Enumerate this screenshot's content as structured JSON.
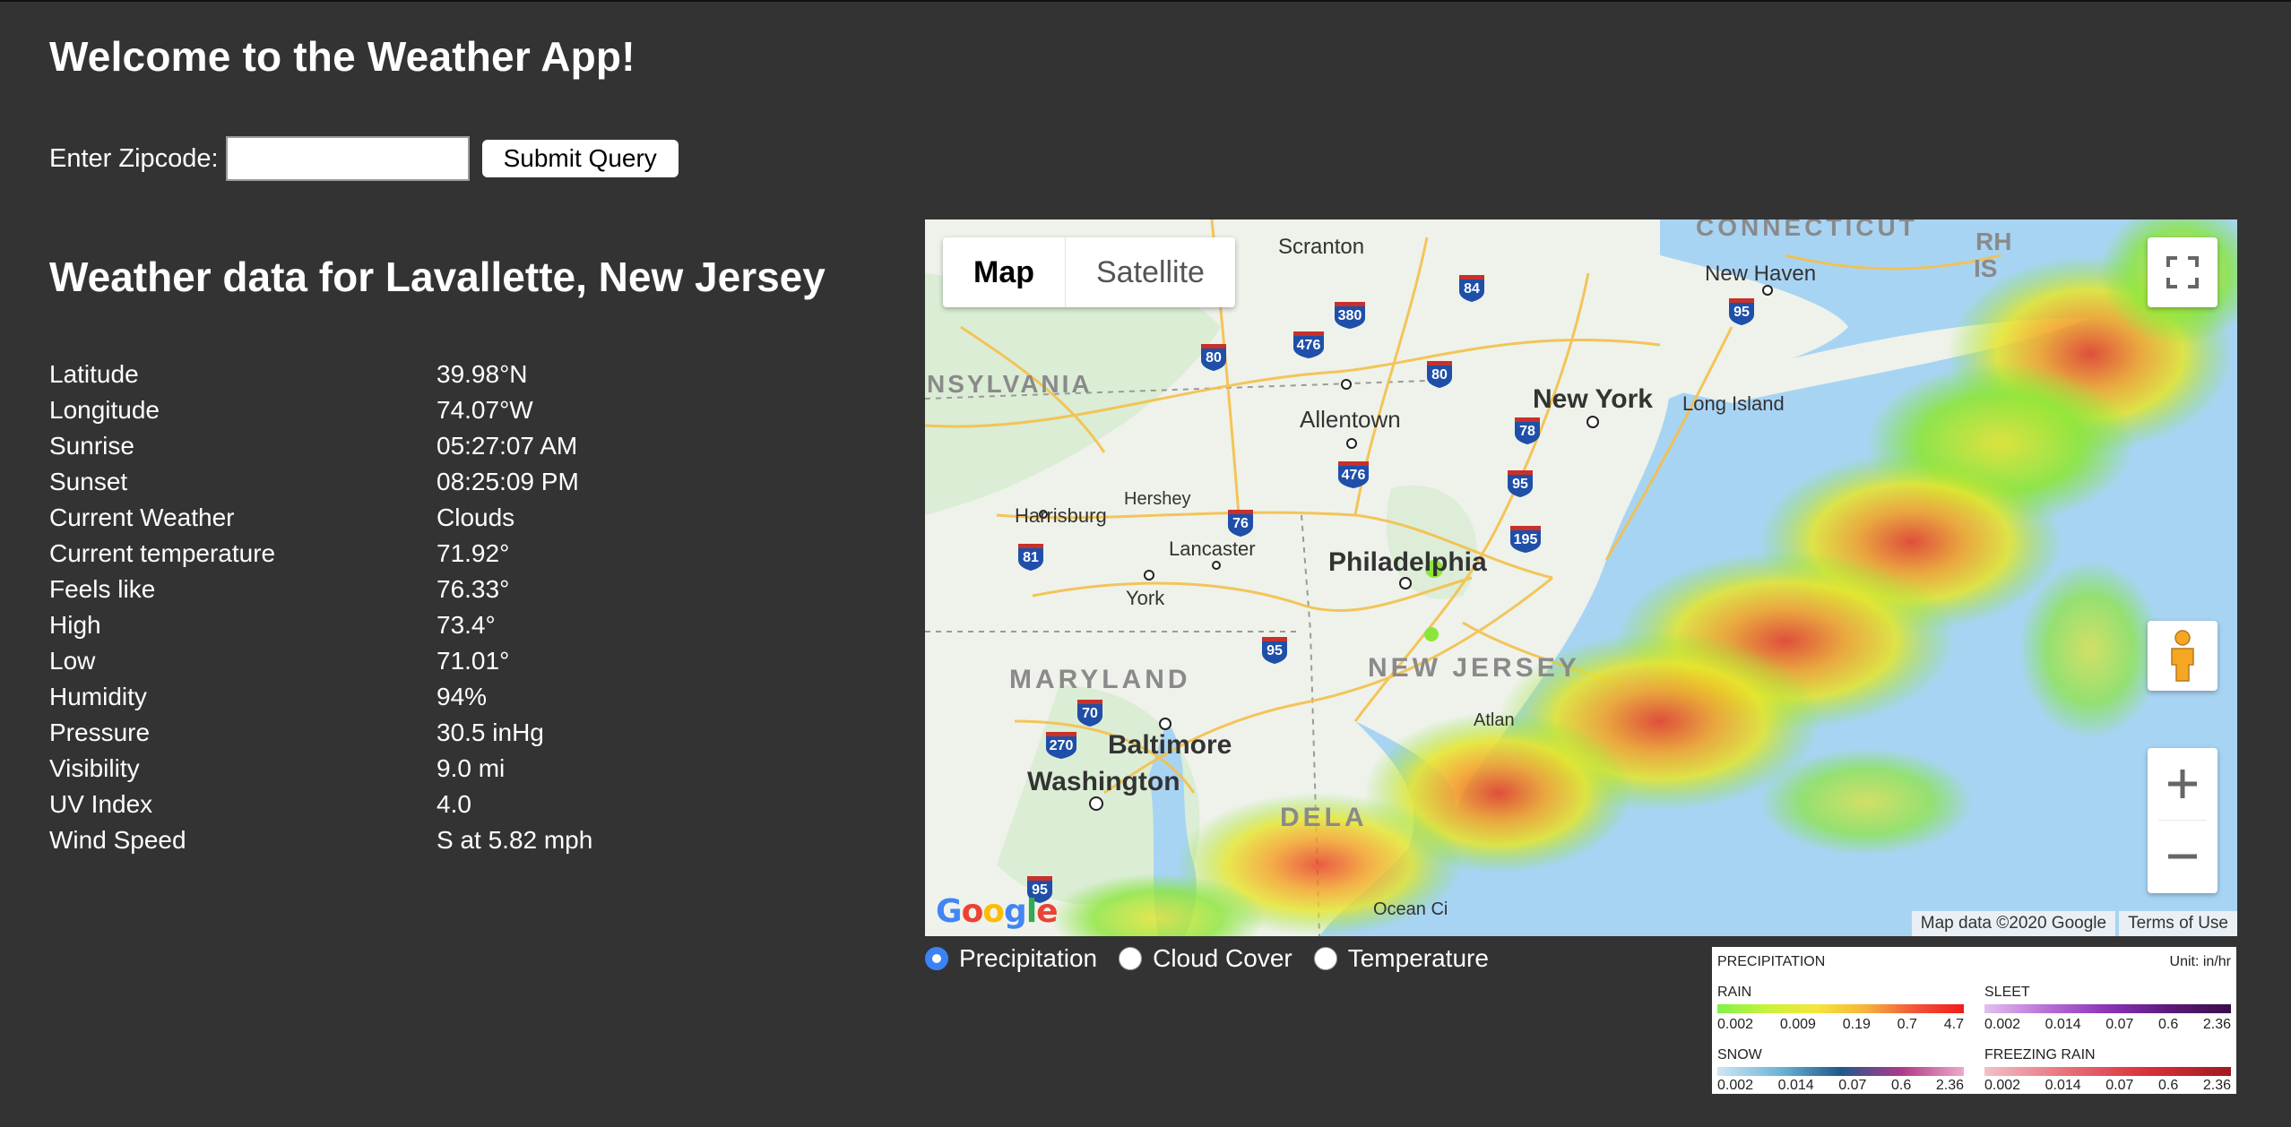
{
  "app": {
    "title": "Welcome to the Weather App!"
  },
  "zip_form": {
    "label": "Enter Zipcode:",
    "value": "",
    "submit_label": "Submit Query"
  },
  "location": {
    "heading": "Weather data for Lavallette, New Jersey"
  },
  "weather": {
    "rows": [
      {
        "label": "Latitude",
        "value": "39.98°N"
      },
      {
        "label": "Longitude",
        "value": "74.07°W"
      },
      {
        "label": "Sunrise",
        "value": "05:27:07 AM"
      },
      {
        "label": "Sunset",
        "value": "08:25:09 PM"
      },
      {
        "label": "Current Weather",
        "value": "Clouds"
      },
      {
        "label": "Current temperature",
        "value": "71.92°"
      },
      {
        "label": "Feels like",
        "value": "76.33°"
      },
      {
        "label": "High",
        "value": "73.4°"
      },
      {
        "label": "Low",
        "value": "71.01°"
      },
      {
        "label": "Humidity",
        "value": "94%"
      },
      {
        "label": "Pressure",
        "value": "30.5 inHg"
      },
      {
        "label": "Visibility",
        "value": "9.0 mi"
      },
      {
        "label": "UV Index",
        "value": "4.0"
      },
      {
        "label": "Wind Speed",
        "value": "S at 5.82 mph"
      }
    ]
  },
  "map": {
    "type_options": [
      "Map",
      "Satellite"
    ],
    "selected_type": "Map",
    "icons": [
      "fullscreen-icon",
      "pegman-icon",
      "zoom-in-icon",
      "zoom-out-icon"
    ],
    "logo": "Google",
    "attribution": "Map data ©2020 Google",
    "terms": "Terms of Use",
    "labels": {
      "connecticut": "CONNECTICUT",
      "rhode_island_a": "RH",
      "rhode_island_b": "IS",
      "scranton": "Scranton",
      "new_haven": "New Haven",
      "pennsylvania": "NSYLVANIA",
      "new_york": "New York",
      "long_island": "Long Island",
      "allentown": "Allentown",
      "harrisburg": "Harrisburg",
      "hershey": "Hershey",
      "lancaster": "Lancaster",
      "philadelphia": "Philadelphia",
      "york": "York",
      "maryland": "MARYLAND",
      "new_jersey": "NEW JERSEY",
      "atlantic": "Atlan",
      "baltimore": "Baltimore",
      "washington": "Washington",
      "delaware": "DELA",
      "ocean_city": "Ocean Ci"
    },
    "highway_shields": [
      "84",
      "380",
      "476",
      "80",
      "80",
      "95",
      "78",
      "476",
      "95",
      "76",
      "195",
      "81",
      "95",
      "70",
      "270",
      "95"
    ]
  },
  "layers": {
    "options": [
      "Precipitation",
      "Cloud Cover",
      "Temperature"
    ],
    "selected": "Precipitation"
  },
  "legend": {
    "title": "PRECIPITATION",
    "unit": "Unit: in/hr",
    "rain": {
      "label": "RAIN",
      "ticks": [
        "0.002",
        "0.009",
        "0.19",
        "0.7",
        "4.7"
      ]
    },
    "sleet": {
      "label": "SLEET",
      "ticks": [
        "0.002",
        "0.014",
        "0.07",
        "0.6",
        "2.36"
      ]
    },
    "snow": {
      "label": "SNOW",
      "ticks": [
        "0.002",
        "0.014",
        "0.07",
        "0.6",
        "2.36"
      ]
    },
    "freezing_rain": {
      "label": "FREEZING RAIN",
      "ticks": [
        "0.002",
        "0.014",
        "0.07",
        "0.6",
        "2.36"
      ]
    },
    "colors": {
      "rain": [
        "#7ff24a",
        "#c8f23a",
        "#f5e63a",
        "#f5b53a",
        "#f2553a"
      ],
      "sleet": [
        "#d9a8e8",
        "#b770d6",
        "#8a34b8",
        "#5a1a7a"
      ],
      "snow": [
        "#cfe7f2",
        "#6fb5d6",
        "#1e5a8a",
        "#b03a8a",
        "#f0a8c8"
      ],
      "freezing_rain": [
        "#f2c0c8",
        "#e8707a",
        "#d8303a",
        "#a01a22"
      ]
    }
  }
}
